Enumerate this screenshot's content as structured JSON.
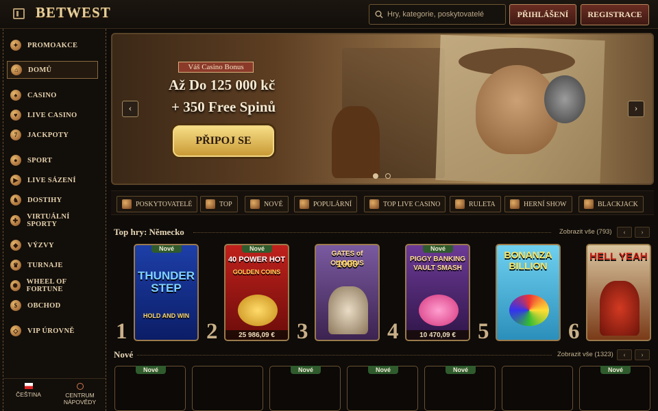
{
  "header": {
    "logo": "BETWEST",
    "search_placeholder": "Hry, kategorie, poskytovatelé",
    "login_label": "PŘIHLÁŠENÍ",
    "register_label": "REGISTRACE"
  },
  "sidebar": {
    "items": [
      {
        "label": "PROMOAKCE",
        "icon": "gift-icon"
      },
      {
        "label": "DOMŮ",
        "icon": "home-icon"
      },
      {
        "label": "CASINO",
        "icon": "casino-icon"
      },
      {
        "label": "LIVE CASINO",
        "icon": "cards-icon"
      },
      {
        "label": "JACKPOTY",
        "icon": "slot-777-icon"
      },
      {
        "label": "SPORT",
        "icon": "ball-icon"
      },
      {
        "label": "LIVE SÁZENÍ",
        "icon": "live-icon"
      },
      {
        "label": "DOSTIHY",
        "icon": "horse-icon"
      },
      {
        "label": "VIRTUÁLNÍ SPORTY",
        "icon": "joystick-icon"
      },
      {
        "label": "VÝZVY",
        "icon": "challenge-icon"
      },
      {
        "label": "TURNAJE",
        "icon": "trophy-icon"
      },
      {
        "label": "WHEEL OF FORTUNE",
        "icon": "wheel-icon"
      },
      {
        "label": "OBCHOD",
        "icon": "shop-icon"
      },
      {
        "label": "VIP ÚROVNĚ",
        "icon": "diamond-icon"
      }
    ],
    "footer": {
      "language": "ČEŠTINA",
      "help_line1": "CENTRUM",
      "help_line2": "NÁPOVĚDY"
    }
  },
  "banner": {
    "badge": "Váš Casino Bonus",
    "line1": "Až Do 125 000 kč",
    "line2": "+ 350 Free Spinů",
    "cta": "PŘIPOJ SE",
    "prev_icon": "chevron-left-icon",
    "next_icon": "chevron-right-icon",
    "slide_count": 2,
    "active_slide": 1
  },
  "categories": [
    {
      "label": "POSKYTOVATELÉ",
      "icon": "book-icon"
    },
    {
      "label": "TOP",
      "icon": "star-icon"
    },
    {
      "label": "NOVÉ",
      "icon": "lightning-icon"
    },
    {
      "label": "POPULÁRNÍ",
      "icon": "hand-icon"
    },
    {
      "label": "TOP LIVE CASINO",
      "icon": "star-badge-icon"
    },
    {
      "label": "RULETA",
      "icon": "roulette-icon"
    },
    {
      "label": "HERNÍ SHOW",
      "icon": "microphone-icon"
    },
    {
      "label": "BLACKJACK",
      "icon": "cards-icon"
    }
  ],
  "top_games": {
    "title": "Top hry: Německo",
    "show_all": "Zobrazit vše (793)",
    "games": [
      {
        "rank": "1",
        "name": "THUNDER STEP",
        "sub": "HOLD AND WIN",
        "tag": "Nové",
        "jackpot": "",
        "bg": "#1d3fa8"
      },
      {
        "rank": "2",
        "name": "40 POWER HOT",
        "sub": "GOLDEN COINS",
        "tag": "Nové",
        "jackpot": "25 986,09 €",
        "bg": "#9a1612"
      },
      {
        "rank": "3",
        "name": "GATES of OLYMPUS",
        "sub": "1000",
        "tag": "",
        "jackpot": "",
        "bg": "#6b4a8a"
      },
      {
        "rank": "4",
        "name": "PIGGY BANKING",
        "sub": "VAULT SMASH",
        "tag": "Nové",
        "jackpot": "10 470,09 €",
        "bg": "#5a2d7a"
      },
      {
        "rank": "5",
        "name": "BONANZA BILLION",
        "sub": "",
        "tag": "",
        "jackpot": "",
        "bg": "#5ab7d8"
      },
      {
        "rank": "6",
        "name": "HELL YEAH",
        "sub": "",
        "tag": "",
        "jackpot": "",
        "bg": "#5c2a14"
      }
    ]
  },
  "new_games": {
    "title": "Nové",
    "show_all": "Zobrazit vše (1323)",
    "tag": "Nové"
  },
  "pager": {
    "prev": "‹",
    "next": "›"
  }
}
